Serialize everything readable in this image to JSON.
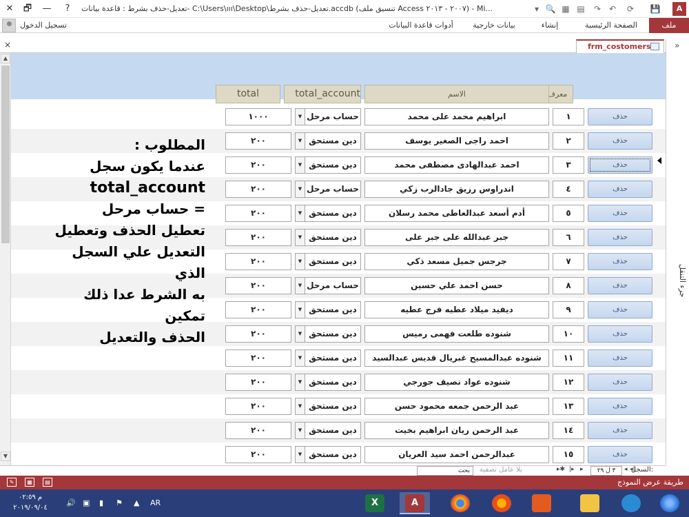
{
  "window": {
    "title": "تعديل-حذف بشرط : قاعدة بيانات- C:\\Users\\ııı\\Desktop\\تعديل-حذف بشرط.accdb (تنسيق ملف Access ٢٠٠٧ - ٢٠١٣) - Mi...",
    "help_glyph": "?",
    "minimize_glyph": "—",
    "restore_glyph": "🗗",
    "close_glyph": "✕",
    "app_icon_label": "A"
  },
  "ribbon": {
    "file_tab": "ملف",
    "tabs": [
      "الصفحة الرئيسية",
      "إنشاء",
      "بيانات خارجية",
      "أدوات قاعدة البيانات"
    ],
    "signin_label": "تسجيل الدخول"
  },
  "document": {
    "tab_label": "frm_costomers",
    "close_glyph": "×"
  },
  "grid": {
    "headers": {
      "id": "معرف",
      "name": "الاسم",
      "account": "total_account",
      "total": "total"
    },
    "delete_label": "حذف",
    "rows": [
      {
        "id": "١",
        "name": "ابراهيم محمد على محمد",
        "account": "حساب مرحل",
        "total": "١٠٠٠"
      },
      {
        "id": "٢",
        "name": "احمد راجى الصغير يوسف",
        "account": "دين مستحق",
        "total": "٢٠٠"
      },
      {
        "id": "٣",
        "name": "احمد عبدالهادى مصطفى محمد",
        "account": "دين مستحق",
        "total": "٢٠٠"
      },
      {
        "id": "٤",
        "name": "اندراوس رزيق جادالرب زكي",
        "account": "حساب مرحل",
        "total": "٢٠٠"
      },
      {
        "id": "٥",
        "name": "أدم أسعد عبدالعاطى محمد رسلان",
        "account": "دين مستحق",
        "total": "٢٠٠"
      },
      {
        "id": "٦",
        "name": "جبر عبدالله على جبر على",
        "account": "دين مستحق",
        "total": "٢٠٠"
      },
      {
        "id": "٧",
        "name": "جرجس جميل مسعد ذكي",
        "account": "دين مستحق",
        "total": "٢٠٠"
      },
      {
        "id": "٨",
        "name": "حسن احمد علي حسين",
        "account": "حساب مرحل",
        "total": "٢٠٠"
      },
      {
        "id": "٩",
        "name": "ديفيد ميلاد عطيه فرج عطيه",
        "account": "دين مستحق",
        "total": "٢٠٠"
      },
      {
        "id": "١٠",
        "name": "شنوده طلعت فهمى رميس",
        "account": "دين مستحق",
        "total": "٢٠٠"
      },
      {
        "id": "١١",
        "name": "شنوده عبدالمسيح غبريال قديس عبدالسيد",
        "account": "دين مستحق",
        "total": "٢٠٠"
      },
      {
        "id": "١٢",
        "name": "شنوده عواد نصيف جورجي",
        "account": "دين مستحق",
        "total": "٢٠٠"
      },
      {
        "id": "١٣",
        "name": "عبد الرحمن جمعه محمود حسن",
        "account": "دين مستحق",
        "total": "٢٠٠"
      },
      {
        "id": "١٤",
        "name": "عبد الرحمن ريان ابراهيم بخيت",
        "account": "دين مستحق",
        "total": "٢٠٠"
      },
      {
        "id": "١٥",
        "name": "عبدالرحمن احمد سيد العريان",
        "account": "دين مستحق",
        "total": "٢٠٠"
      }
    ]
  },
  "note_lines": [
    "المطلوب :",
    "عندما يكون سجل",
    "total_account",
    "= حساب مرحل",
    "تعطيل الحذف وتعطيل",
    "التعديل علي السجل الذي",
    "به الشرط عدا ذلك تمكين",
    "الحذف والتعديل"
  ],
  "nav_pane": {
    "label": "جزء التنقل",
    "expand_glyph": "»"
  },
  "record_nav": {
    "label": "السجل:",
    "count": "٣ ل ٢٩",
    "filter": "بلا عامل تصفية",
    "search": "بحث"
  },
  "status": {
    "text": "طريقة عرض النموذج"
  },
  "taskbar": {
    "time": "م ٠٢:٥٩",
    "date": "٢٠١٩/٠٩/٠٤",
    "lang": "AR",
    "excel_label": "X",
    "access_label": "A",
    "colors": {
      "excel": "#1e7145",
      "access": "#a4373a"
    }
  }
}
